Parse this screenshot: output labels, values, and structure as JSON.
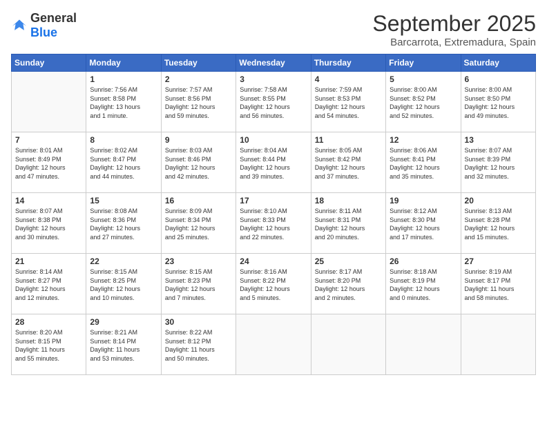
{
  "header": {
    "logo_general": "General",
    "logo_blue": "Blue",
    "month": "September 2025",
    "location": "Barcarrota, Extremadura, Spain"
  },
  "weekdays": [
    "Sunday",
    "Monday",
    "Tuesday",
    "Wednesday",
    "Thursday",
    "Friday",
    "Saturday"
  ],
  "weeks": [
    [
      {
        "day": "",
        "info": ""
      },
      {
        "day": "1",
        "info": "Sunrise: 7:56 AM\nSunset: 8:58 PM\nDaylight: 13 hours\nand 1 minute."
      },
      {
        "day": "2",
        "info": "Sunrise: 7:57 AM\nSunset: 8:56 PM\nDaylight: 12 hours\nand 59 minutes."
      },
      {
        "day": "3",
        "info": "Sunrise: 7:58 AM\nSunset: 8:55 PM\nDaylight: 12 hours\nand 56 minutes."
      },
      {
        "day": "4",
        "info": "Sunrise: 7:59 AM\nSunset: 8:53 PM\nDaylight: 12 hours\nand 54 minutes."
      },
      {
        "day": "5",
        "info": "Sunrise: 8:00 AM\nSunset: 8:52 PM\nDaylight: 12 hours\nand 52 minutes."
      },
      {
        "day": "6",
        "info": "Sunrise: 8:00 AM\nSunset: 8:50 PM\nDaylight: 12 hours\nand 49 minutes."
      }
    ],
    [
      {
        "day": "7",
        "info": "Sunrise: 8:01 AM\nSunset: 8:49 PM\nDaylight: 12 hours\nand 47 minutes."
      },
      {
        "day": "8",
        "info": "Sunrise: 8:02 AM\nSunset: 8:47 PM\nDaylight: 12 hours\nand 44 minutes."
      },
      {
        "day": "9",
        "info": "Sunrise: 8:03 AM\nSunset: 8:46 PM\nDaylight: 12 hours\nand 42 minutes."
      },
      {
        "day": "10",
        "info": "Sunrise: 8:04 AM\nSunset: 8:44 PM\nDaylight: 12 hours\nand 39 minutes."
      },
      {
        "day": "11",
        "info": "Sunrise: 8:05 AM\nSunset: 8:42 PM\nDaylight: 12 hours\nand 37 minutes."
      },
      {
        "day": "12",
        "info": "Sunrise: 8:06 AM\nSunset: 8:41 PM\nDaylight: 12 hours\nand 35 minutes."
      },
      {
        "day": "13",
        "info": "Sunrise: 8:07 AM\nSunset: 8:39 PM\nDaylight: 12 hours\nand 32 minutes."
      }
    ],
    [
      {
        "day": "14",
        "info": "Sunrise: 8:07 AM\nSunset: 8:38 PM\nDaylight: 12 hours\nand 30 minutes."
      },
      {
        "day": "15",
        "info": "Sunrise: 8:08 AM\nSunset: 8:36 PM\nDaylight: 12 hours\nand 27 minutes."
      },
      {
        "day": "16",
        "info": "Sunrise: 8:09 AM\nSunset: 8:34 PM\nDaylight: 12 hours\nand 25 minutes."
      },
      {
        "day": "17",
        "info": "Sunrise: 8:10 AM\nSunset: 8:33 PM\nDaylight: 12 hours\nand 22 minutes."
      },
      {
        "day": "18",
        "info": "Sunrise: 8:11 AM\nSunset: 8:31 PM\nDaylight: 12 hours\nand 20 minutes."
      },
      {
        "day": "19",
        "info": "Sunrise: 8:12 AM\nSunset: 8:30 PM\nDaylight: 12 hours\nand 17 minutes."
      },
      {
        "day": "20",
        "info": "Sunrise: 8:13 AM\nSunset: 8:28 PM\nDaylight: 12 hours\nand 15 minutes."
      }
    ],
    [
      {
        "day": "21",
        "info": "Sunrise: 8:14 AM\nSunset: 8:27 PM\nDaylight: 12 hours\nand 12 minutes."
      },
      {
        "day": "22",
        "info": "Sunrise: 8:15 AM\nSunset: 8:25 PM\nDaylight: 12 hours\nand 10 minutes."
      },
      {
        "day": "23",
        "info": "Sunrise: 8:15 AM\nSunset: 8:23 PM\nDaylight: 12 hours\nand 7 minutes."
      },
      {
        "day": "24",
        "info": "Sunrise: 8:16 AM\nSunset: 8:22 PM\nDaylight: 12 hours\nand 5 minutes."
      },
      {
        "day": "25",
        "info": "Sunrise: 8:17 AM\nSunset: 8:20 PM\nDaylight: 12 hours\nand 2 minutes."
      },
      {
        "day": "26",
        "info": "Sunrise: 8:18 AM\nSunset: 8:19 PM\nDaylight: 12 hours\nand 0 minutes."
      },
      {
        "day": "27",
        "info": "Sunrise: 8:19 AM\nSunset: 8:17 PM\nDaylight: 11 hours\nand 58 minutes."
      }
    ],
    [
      {
        "day": "28",
        "info": "Sunrise: 8:20 AM\nSunset: 8:15 PM\nDaylight: 11 hours\nand 55 minutes."
      },
      {
        "day": "29",
        "info": "Sunrise: 8:21 AM\nSunset: 8:14 PM\nDaylight: 11 hours\nand 53 minutes."
      },
      {
        "day": "30",
        "info": "Sunrise: 8:22 AM\nSunset: 8:12 PM\nDaylight: 11 hours\nand 50 minutes."
      },
      {
        "day": "",
        "info": ""
      },
      {
        "day": "",
        "info": ""
      },
      {
        "day": "",
        "info": ""
      },
      {
        "day": "",
        "info": ""
      }
    ]
  ]
}
